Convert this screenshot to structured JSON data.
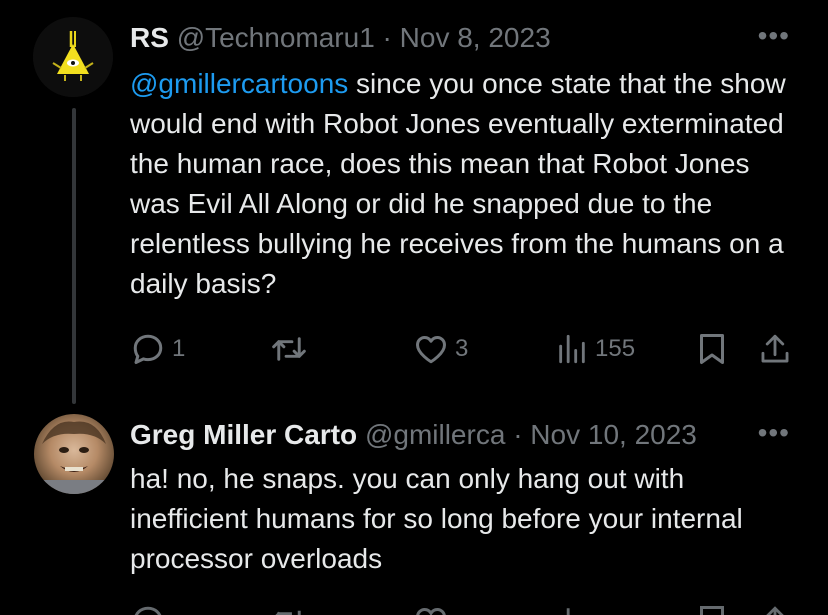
{
  "tweet1": {
    "display_name": "RS",
    "handle": "@Technomaru1",
    "separator": "·",
    "date": "Nov 8, 2023",
    "more": "•••",
    "mention": "@gmillercartoons",
    "text": " since you once state that the show would end with Robot Jones eventually exterminated the human race, does this mean that Robot Jones was Evil All Along or did he snapped due to the relentless bullying he receives from the humans on a daily basis?",
    "replies": "1",
    "retweets": "",
    "likes": "3",
    "views": "155"
  },
  "tweet2": {
    "display_name": "Greg Miller Carto",
    "handle": "@gmillerca",
    "separator": "·",
    "date": "Nov 10, 2023",
    "more": "•••",
    "text": "ha! no, he snaps. you can only hang out with inefficient humans for so long before your internal processor overloads"
  },
  "icons": [
    "triangle-eye-avatar",
    "reply-icon",
    "retweet-icon",
    "like-icon",
    "views-icon",
    "bookmark-icon",
    "share-icon",
    "more-icon"
  ],
  "colors": {
    "background": "#000000",
    "text": "#e7e9ea",
    "muted": "#71767b",
    "link": "#1d9bf0"
  }
}
